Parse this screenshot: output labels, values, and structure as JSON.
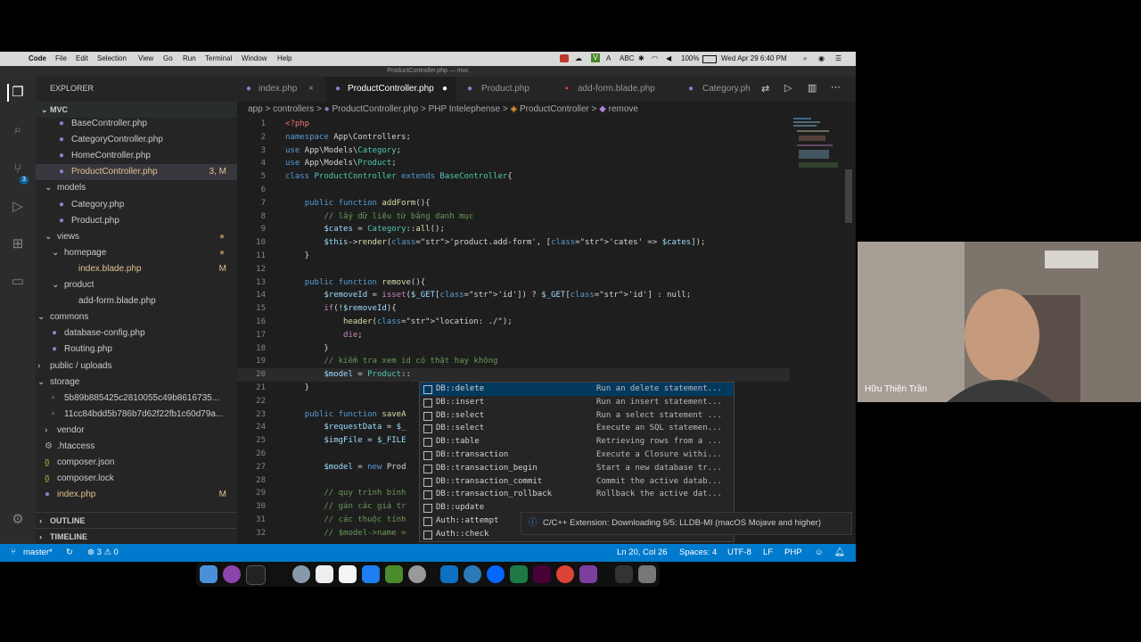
{
  "menubar": {
    "app": "Code",
    "items": [
      "File",
      "Edit",
      "Selection",
      "View",
      "Go",
      "Run",
      "Terminal",
      "Window",
      "Help"
    ],
    "right": {
      "abc": "ABC",
      "battery": "100%",
      "datetime": "Wed Apr 29  6:40 PM"
    }
  },
  "titlebar": "ProductController.php — mvc",
  "tabs": [
    {
      "label": "index.php",
      "icon": "php-icon",
      "close": "×"
    },
    {
      "label": "ProductController.php",
      "icon": "php-icon",
      "dirty": "●"
    },
    {
      "label": "Product.php",
      "icon": "php-icon"
    },
    {
      "label": "add-form.blade.php",
      "icon": "blade-icon"
    },
    {
      "label": "Category.ph",
      "icon": "php-icon"
    }
  ],
  "breadcrumb": [
    "app",
    ">",
    "controllers",
    ">",
    "ProductController.php",
    ">",
    "PHP Intelephense",
    ">",
    "ProductController",
    ">",
    "remove"
  ],
  "explorer": {
    "title": "EXPLORER",
    "root": "MVC",
    "rows": [
      {
        "label": "BaseController.php",
        "badge": ""
      },
      {
        "label": "CategoryController.php",
        "badge": ""
      },
      {
        "label": "HomeController.php",
        "badge": ""
      },
      {
        "label": "ProductController.php",
        "badge": "3, M"
      },
      {
        "label": "models",
        "badge": ""
      },
      {
        "label": "Category.php",
        "badge": ""
      },
      {
        "label": "Product.php",
        "badge": ""
      },
      {
        "label": "views",
        "badge": ""
      },
      {
        "label": "homepage",
        "badge": ""
      },
      {
        "label": "index.blade.php",
        "badge": "M"
      },
      {
        "label": "product",
        "badge": ""
      },
      {
        "label": "add-form.blade.php",
        "badge": ""
      },
      {
        "label": "commons",
        "badge": ""
      },
      {
        "label": "database-config.php",
        "badge": ""
      },
      {
        "label": "Routing.php",
        "badge": ""
      },
      {
        "label": "public / uploads",
        "badge": ""
      },
      {
        "label": "storage",
        "badge": ""
      },
      {
        "label": "5b89b885425c2810055c49b8616735...",
        "badge": ""
      },
      {
        "label": "11cc84bdd5b786b7d62f22fb1c60d79a...",
        "badge": ""
      },
      {
        "label": "vendor",
        "badge": ""
      },
      {
        "label": ".htaccess",
        "badge": ""
      },
      {
        "label": "composer.json",
        "badge": ""
      },
      {
        "label": "composer.lock",
        "badge": ""
      },
      {
        "label": "index.php",
        "badge": "M"
      }
    ],
    "outline": "OUTLINE",
    "timeline": "TIMELINE"
  },
  "code": [
    {
      "n": "1",
      "t": "<?php"
    },
    {
      "n": "2",
      "t": "namespace App\\Controllers;"
    },
    {
      "n": "3",
      "t": "use App\\Models\\Category;"
    },
    {
      "n": "4",
      "t": "use App\\Models\\Product;"
    },
    {
      "n": "5",
      "t": "class ProductController extends BaseController{"
    },
    {
      "n": "6",
      "t": ""
    },
    {
      "n": "7",
      "t": "    public function addForm(){"
    },
    {
      "n": "8",
      "t": "        // lấy dữ liệu từ bảng danh mục"
    },
    {
      "n": "9",
      "t": "        $cates = Category::all();"
    },
    {
      "n": "10",
      "t": "        $this->render('product.add-form', ['cates' => $cates]);"
    },
    {
      "n": "11",
      "t": "    }"
    },
    {
      "n": "12",
      "t": ""
    },
    {
      "n": "13",
      "t": "    public function remove(){"
    },
    {
      "n": "14",
      "t": "        $removeId = isset($_GET['id']) ? $_GET['id'] : null;"
    },
    {
      "n": "15",
      "t": "        if(!$removeId){"
    },
    {
      "n": "16",
      "t": "            header(\"location: ./\");"
    },
    {
      "n": "17",
      "t": "            die;"
    },
    {
      "n": "18",
      "t": "        }"
    },
    {
      "n": "19",
      "t": "        // kiểm tra xem id có thật hay không"
    },
    {
      "n": "20",
      "t": "        $model = Product::"
    },
    {
      "n": "21",
      "t": "    }"
    },
    {
      "n": "22",
      "t": ""
    },
    {
      "n": "23",
      "t": "    public function saveA"
    },
    {
      "n": "24",
      "t": "        $requestData = $_"
    },
    {
      "n": "25",
      "t": "        $imgFile = $_FILE"
    },
    {
      "n": "26",
      "t": ""
    },
    {
      "n": "27",
      "t": "        $model = new Prod"
    },
    {
      "n": "28",
      "t": ""
    },
    {
      "n": "29",
      "t": "        // quy trình binh"
    },
    {
      "n": "30",
      "t": "        // gán các giá tr"
    },
    {
      "n": "31",
      "t": "        // các thuộc tính"
    },
    {
      "n": "32",
      "t": "        // $model->name ="
    }
  ],
  "suggestions": [
    {
      "label": "DB::delete",
      "detail": "Run an delete statement..."
    },
    {
      "label": "DB::insert",
      "detail": "Run an insert statement..."
    },
    {
      "label": "DB::select",
      "detail": "Run a select statement ..."
    },
    {
      "label": "DB::select",
      "detail": "Execute an SQL statemen..."
    },
    {
      "label": "DB::table",
      "detail": "Retrieving rows from a ..."
    },
    {
      "label": "DB::transaction",
      "detail": "Execute a Closure withi..."
    },
    {
      "label": "DB::transaction_begin",
      "detail": "Start a new database tr..."
    },
    {
      "label": "DB::transaction_commit",
      "detail": "Commit the active datab..."
    },
    {
      "label": "DB::transaction_rollback",
      "detail": "Rollback the active dat..."
    },
    {
      "label": "DB::update",
      "detail": ""
    },
    {
      "label": "Auth::attempt",
      "detail": ""
    },
    {
      "label": "Auth::check",
      "detail": ""
    }
  ],
  "notification": "C/C++ Extension: Downloading 5/5: LLDB-MI (macOS Mojave and higher)",
  "statusbar": {
    "branch": "master*",
    "problems": "⊗ 3 ⚠ 0",
    "position": "Ln 20, Col 26",
    "spaces": "Spaces: 4",
    "encoding": "UTF-8",
    "eol": "LF",
    "language": "PHP"
  },
  "webcam": {
    "name": "Hữu Thiện Trần"
  }
}
